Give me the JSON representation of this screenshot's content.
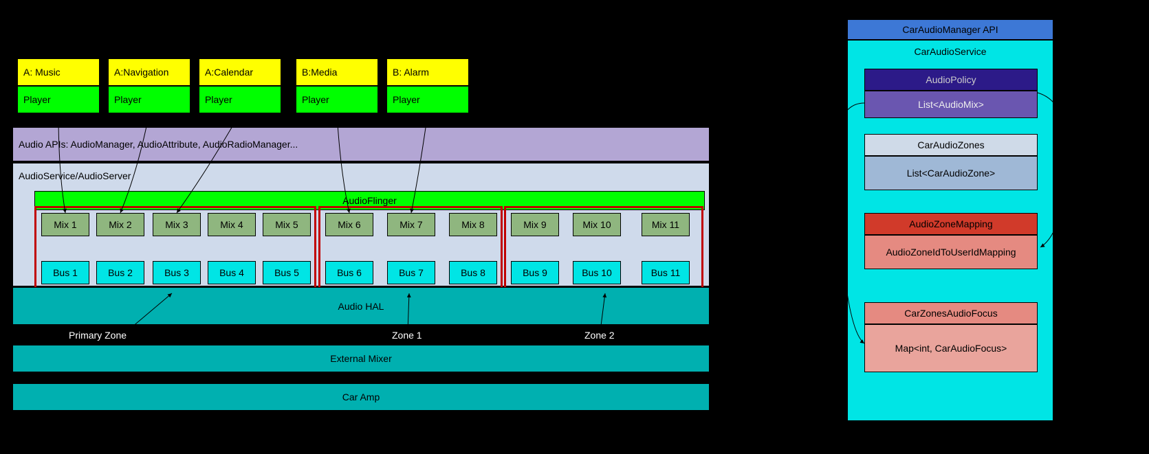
{
  "apps": [
    {
      "attr": "A: Music",
      "player": "Player"
    },
    {
      "attr": "A:Navigation",
      "player": "Player"
    },
    {
      "attr": "A:Calendar",
      "player": "Player"
    },
    {
      "attr": "B:Media",
      "player": "Player"
    },
    {
      "attr": "B: Alarm",
      "player": "Player"
    }
  ],
  "audio_apis": "Audio APIs: AudioManager, AudioAttribute, AudioRadioManager...",
  "audio_service": "AudioService/AudioServer",
  "audio_flinger": "AudioFlinger",
  "mixes": [
    "Mix 1",
    "Mix 2",
    "Mix 3",
    "Mix 4",
    "Mix 5",
    "Mix 6",
    "Mix 7",
    "Mix 8",
    "Mix 9",
    "Mix 10",
    "Mix 11"
  ],
  "buses": [
    "Bus 1",
    "Bus 2",
    "Bus 3",
    "Bus 4",
    "Bus 5",
    "Bus 6",
    "Bus 7",
    "Bus 8",
    "Bus 9",
    "Bus 10",
    "Bus 11"
  ],
  "audio_hal": "Audio HAL",
  "external_mixer": "External Mixer",
  "car_amp": "Car Amp",
  "zone_labels": [
    "Primary Zone",
    "Zone 1",
    "Zone 2"
  ],
  "right": {
    "api_header": "CarAudioManager API",
    "service": "CarAudioService",
    "audiopolicy_h": "AudioPolicy",
    "audiopolicy_b": "List<AudioMix>",
    "zones_h": "CarAudioZones",
    "zones_b": "List<CarAudioZone>",
    "zonemap_h": "AudioZoneMapping",
    "zonemap_b": "AudioZoneIdToUserIdMapping",
    "focus_h": "CarZonesAudioFocus",
    "focus_b": "Map<int, CarAudioFocus>"
  }
}
